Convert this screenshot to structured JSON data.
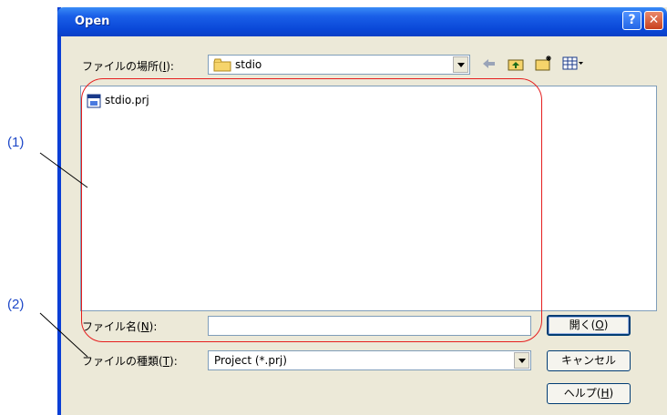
{
  "window": {
    "title": "Open"
  },
  "look_in": {
    "label": "ファイルの場所(",
    "accel": "I",
    "label_end": "):",
    "value": "stdio"
  },
  "file_list": {
    "items": [
      {
        "name": "stdio.prj"
      }
    ]
  },
  "file_name": {
    "label": "ファイル名(",
    "accel": "N",
    "label_end": "):",
    "value": ""
  },
  "file_type": {
    "label": "ファイルの種類(",
    "accel": "T",
    "label_end": "):",
    "value": "Project (*.prj)"
  },
  "buttons": {
    "open": {
      "label": "開く(",
      "accel": "O",
      "label_end": ")"
    },
    "cancel": "キャンセル",
    "help": {
      "label": "ヘルプ(",
      "accel": "H",
      "label_end": ")"
    }
  },
  "annotations": {
    "callout1": "(1)",
    "callout2": "(2)"
  },
  "colors": {
    "titlebar": "#0a48d8",
    "annotation_oval": "#e61e1e",
    "callout_text": "#1e48c8"
  }
}
